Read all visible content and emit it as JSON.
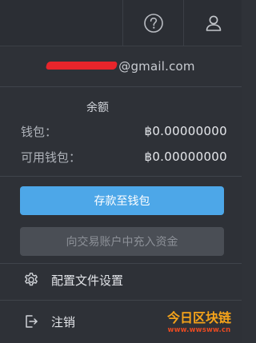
{
  "header": {
    "help_icon": "question-circle-icon",
    "user_icon": "user-icon"
  },
  "account": {
    "email_suffix": "@gmail.com"
  },
  "balance": {
    "title": "余额",
    "wallet_label": "钱包：",
    "wallet_value": "฿0.00000000",
    "available_label": "可用钱包：",
    "available_value": "฿0.00000000"
  },
  "actions": {
    "deposit_label": "存款至钱包",
    "transfer_label": "向交易账户中充入资金"
  },
  "menu": {
    "settings_label": "配置文件设置",
    "settings_icon": "gear-icon",
    "logout_label": "注销",
    "logout_icon": "logout-icon"
  },
  "watermark": {
    "title": "今日区块链",
    "url": "www.wwsww.cn"
  },
  "colors": {
    "accent": "#4da7e8",
    "disabled_button": "#4a4e55",
    "background": "#2f3238"
  }
}
